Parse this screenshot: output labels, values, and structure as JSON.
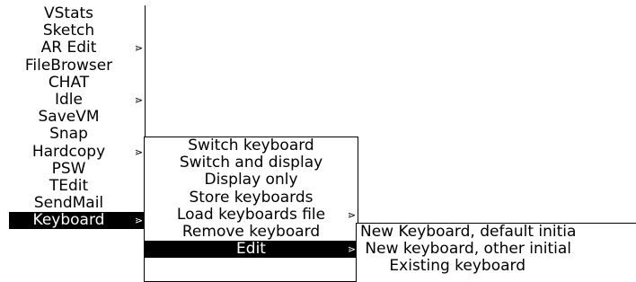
{
  "main_menu": {
    "items": [
      {
        "label": "VStats",
        "arrow": ""
      },
      {
        "label": "Sketch",
        "arrow": ""
      },
      {
        "label": "AR Edit",
        "arrow": "⋗"
      },
      {
        "label": "FileBrowser",
        "arrow": ""
      },
      {
        "label": "CHAT",
        "arrow": ""
      },
      {
        "label": "Idle",
        "arrow": "⋗"
      },
      {
        "label": "SaveVM",
        "arrow": ""
      },
      {
        "label": "Snap",
        "arrow": ""
      },
      {
        "label": "Hardcopy",
        "arrow": "⋗"
      },
      {
        "label": "PSW",
        "arrow": ""
      },
      {
        "label": "TEdit",
        "arrow": ""
      },
      {
        "label": "SendMail",
        "arrow": ""
      },
      {
        "label": "Keyboard",
        "arrow": "⋗"
      }
    ]
  },
  "keyboard_menu": {
    "items": [
      {
        "label": "Switch keyboard",
        "arrow": ""
      },
      {
        "label": "Switch and display",
        "arrow": ""
      },
      {
        "label": "Display only",
        "arrow": ""
      },
      {
        "label": "Store keyboards",
        "arrow": ""
      },
      {
        "label": "Load keyboards file",
        "arrow": "⋗"
      },
      {
        "label": "Remove keyboard",
        "arrow": ""
      },
      {
        "label": "Edit",
        "arrow": "⋗"
      }
    ]
  },
  "edit_menu": {
    "items": [
      {
        "label": "New Keyboard, default initia"
      },
      {
        "label": " New keyboard, other initial"
      },
      {
        "label": "      Existing keyboard"
      }
    ]
  }
}
